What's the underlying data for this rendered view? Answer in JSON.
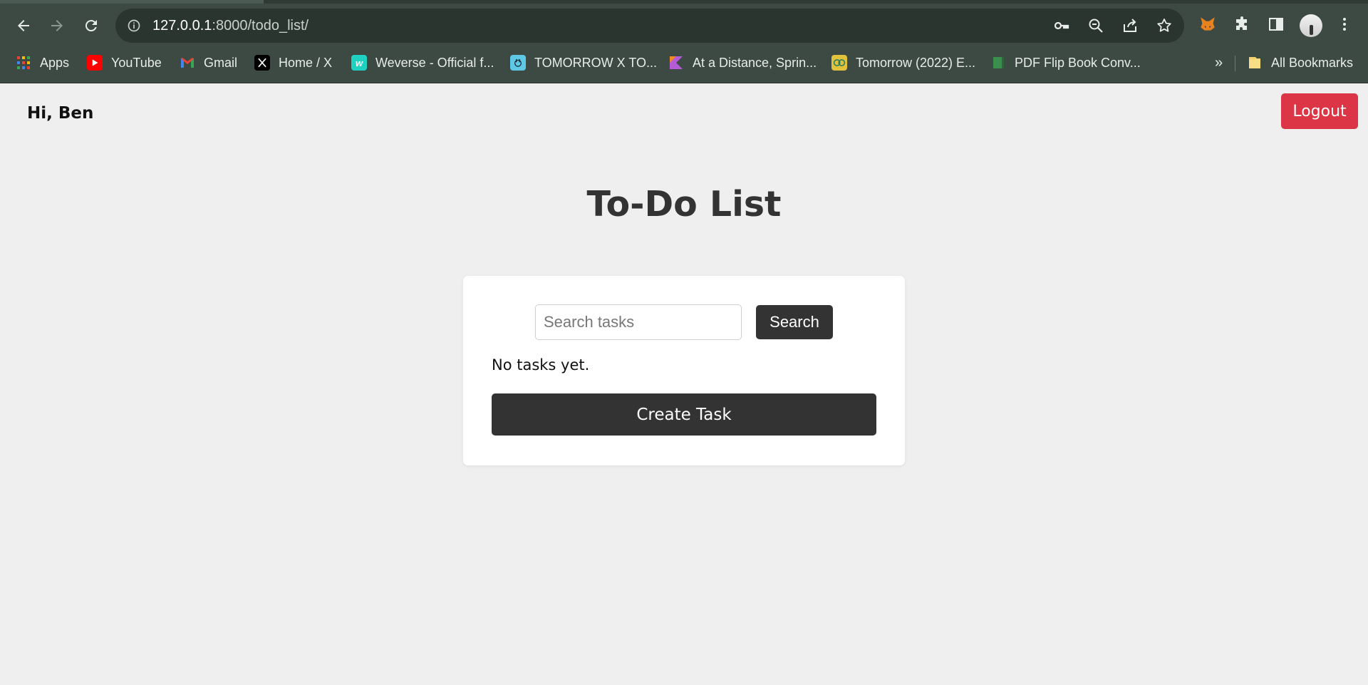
{
  "browser": {
    "url_host": "127.0.0.1",
    "url_rest": ":8000/todo_list/",
    "icons": [
      "back-arrow-icon",
      "forward-arrow-icon",
      "reload-icon",
      "site-info-icon",
      "key-icon",
      "zoom-out-icon",
      "share-icon",
      "star-icon",
      "metamask-fox-icon",
      "extensions-puzzle-icon",
      "side-panel-icon",
      "profile-avatar",
      "more-menu-icon"
    ],
    "bookmarks": [
      {
        "label": "Apps",
        "icon": "apps-grid-icon"
      },
      {
        "label": "YouTube",
        "icon": "youtube-icon",
        "color": "#ff0000"
      },
      {
        "label": "Gmail",
        "icon": "gmail-icon"
      },
      {
        "label": "Home / X",
        "icon": "x-logo-icon"
      },
      {
        "label": "Weverse - Official f...",
        "icon": "weverse-icon",
        "color": "#1fd1c1"
      },
      {
        "label": "TOMORROW X TO...",
        "icon": "txt-icon",
        "color": "#5ec8e6"
      },
      {
        "label": "At a Distance, Sprin...",
        "icon": "kotlin-icon"
      },
      {
        "label": "Tomorrow (2022) E...",
        "icon": "drama-icon"
      },
      {
        "label": "PDF Flip Book Conv...",
        "icon": "book-icon"
      }
    ],
    "overflow_label": "»",
    "all_bookmarks_label": "All Bookmarks"
  },
  "header": {
    "greeting": "Hi, Ben",
    "logout_label": "Logout"
  },
  "main": {
    "title": "To-Do List",
    "search_placeholder": "Search tasks",
    "search_value": "",
    "search_label": "Search",
    "empty_message": "No tasks yet.",
    "create_label": "Create Task"
  },
  "colors": {
    "accent_danger": "#dc3545",
    "button_dark": "#333333",
    "page_bg": "#efefef",
    "chrome_bg": "#3c4a43"
  }
}
